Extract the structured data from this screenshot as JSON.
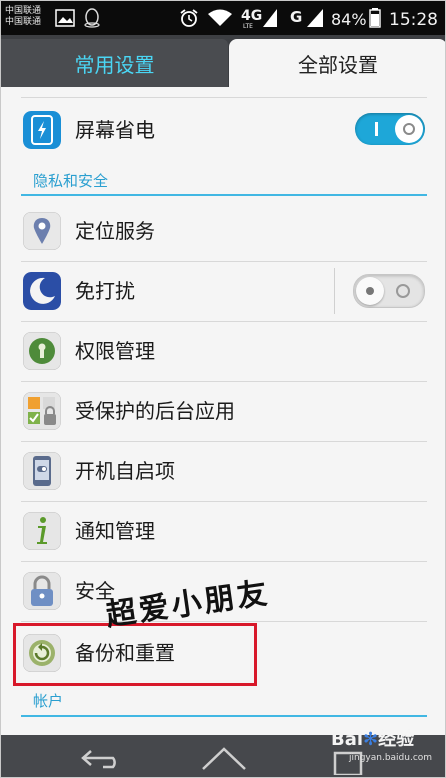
{
  "status_bar": {
    "carrier_line1": "中国联通",
    "carrier_line2": "中国联通",
    "network1": "4G",
    "network1_sub": "LTE",
    "network2": "G",
    "battery": "84%",
    "time": "15:28"
  },
  "tabs": [
    {
      "label": "常用设置",
      "selected": false
    },
    {
      "label": "全部设置",
      "selected": true
    }
  ],
  "rows": {
    "screen_saver": {
      "label": "屏幕省电",
      "toggle": "on"
    },
    "location": {
      "label": "定位服务"
    },
    "dnd": {
      "label": "免打扰",
      "toggle": "off"
    },
    "permissions": {
      "label": "权限管理"
    },
    "protected_apps": {
      "label": "受保护的后台应用"
    },
    "startup": {
      "label": "开机自启项"
    },
    "notifications": {
      "label": "通知管理"
    },
    "security": {
      "label": "安全"
    },
    "backup": {
      "label": "备份和重置"
    }
  },
  "sections": {
    "privacy": "隐私和安全",
    "accounts": "帐户"
  },
  "watermark": "超爱小朋友",
  "baidu": {
    "brand": "Bai",
    "brand2": "经验",
    "url": "jingyan.baidu.com"
  },
  "colors": {
    "accent": "#2a9fd0",
    "toggle_on": "#1ea7d8",
    "highlight": "#d8182a"
  }
}
